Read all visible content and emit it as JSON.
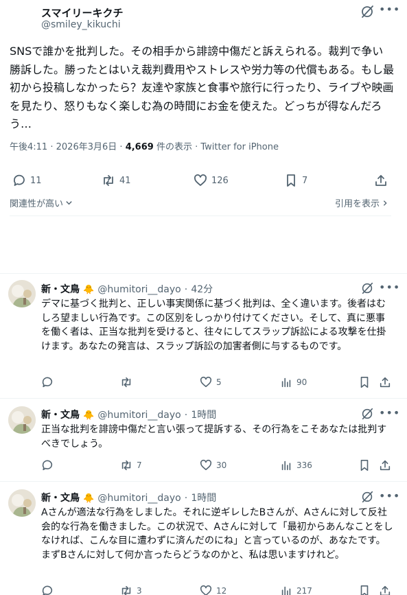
{
  "main_post": {
    "display_name": "スマイリーキクチ",
    "handle": "@smiley_kikuchi",
    "text": "SNSで誰かを批判した。その相手から誹謗中傷だと訴えられる。裁判で争い勝訴した。勝ったとはいえ裁判費用やストレスや労力等の代償もある。もし最初から投稿しなかったら？友達や家族と食事や旅行に行ったり、ライブや映画を見たり、怒りもなく楽しむ為の時間にお金を使えた。どっちが得なんだろう…",
    "time": "午後4:11",
    "date": "2026年3月6日",
    "views_count": "4,669",
    "views_label": "件の表示",
    "source": "Twitter for iPhone",
    "separator": "·",
    "stats": {
      "replies": "11",
      "reposts": "41",
      "likes": "126",
      "bookmarks": "7"
    },
    "sort_label": "関連性が高い",
    "quotes_label": "引用を表示"
  },
  "replies": [
    {
      "display_name": "新・文鳥",
      "badge": "🐥",
      "handle": "@humitori__dayo",
      "time": "42分",
      "text": "デマに基づく批判と、正しい事実関係に基づく批判は、全く違います。後者はむしろ望ましい行為です。この区別をしっかり付けてください。そして、真に悪事を働く者は、正当な批判を受けると、往々にしてスラップ訴訟による攻撃を仕掛けます。あなたの発言は、スラップ訴訟の加害者側に与するものです。",
      "stats": {
        "replies": "",
        "reposts": "",
        "likes": "5",
        "views": "90"
      }
    },
    {
      "display_name": "新・文鳥",
      "badge": "🐥",
      "handle": "@humitori__dayo",
      "time": "1時間",
      "text": "正当な批判を誹謗中傷だと言い張って提訴する、その行為をこそあなたは批判すべきでしょう。",
      "stats": {
        "replies": "",
        "reposts": "7",
        "likes": "30",
        "views": "336"
      }
    },
    {
      "display_name": "新・文鳥",
      "badge": "🐥",
      "handle": "@humitori__dayo",
      "time": "1時間",
      "text": "Aさんが適法な行為をしました。それに逆ギレしたBさんが、Aさんに対して反社会的な行為を働きました。この状況で、Aさんに対して「最初からあんなことをしなければ、こんな目に遭わずに済んだのにね」と言っているのが、あなたです。まずBさんに対して何か言ったらどうなのかと、私は思いますけれど。",
      "stats": {
        "replies": "",
        "reposts": "3",
        "likes": "12",
        "views": "217"
      }
    }
  ],
  "colors": {
    "text": "#0f1419",
    "secondary": "#536471",
    "divider": "#eff3f4"
  }
}
